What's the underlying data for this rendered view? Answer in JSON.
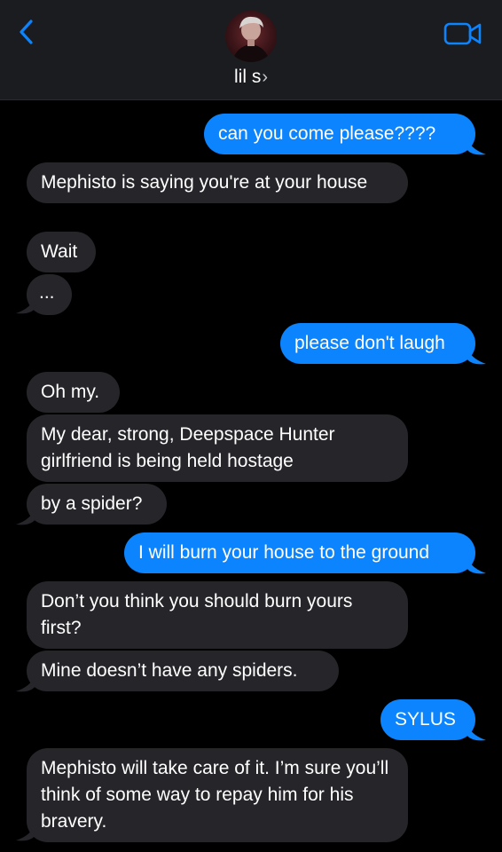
{
  "header": {
    "contact_name": "lil s",
    "chevron": "›",
    "back_icon": "chevron-left-icon",
    "video_icon": "video-camera-icon",
    "accent": "#0b84fe"
  },
  "colors": {
    "outgoing_bubble": "#0b84fe",
    "incoming_bubble": "#26252a",
    "background": "#000000"
  },
  "messages": [
    {
      "from": "me",
      "text": "can you come please????"
    },
    {
      "from": "them",
      "text": "Mephisto is saying you're at your house"
    },
    {
      "from": "them",
      "text": "Wait"
    },
    {
      "from": "them",
      "text": "..."
    },
    {
      "from": "me",
      "text": "please don't laugh"
    },
    {
      "from": "them",
      "text": "Oh my."
    },
    {
      "from": "them",
      "text": "My dear, strong, Deepspace Hunter girlfriend is being held hostage"
    },
    {
      "from": "them",
      "text": "by a spider?"
    },
    {
      "from": "me",
      "text": "I will burn your house to the ground"
    },
    {
      "from": "them",
      "text": "Don’t you think you should burn yours first?"
    },
    {
      "from": "them",
      "text": "Mine doesn’t have any spiders."
    },
    {
      "from": "me",
      "text": "SYLUS"
    },
    {
      "from": "them",
      "text": "Mephisto will take care of it. I’m sure you’ll think of some way to repay him for his bravery."
    }
  ]
}
